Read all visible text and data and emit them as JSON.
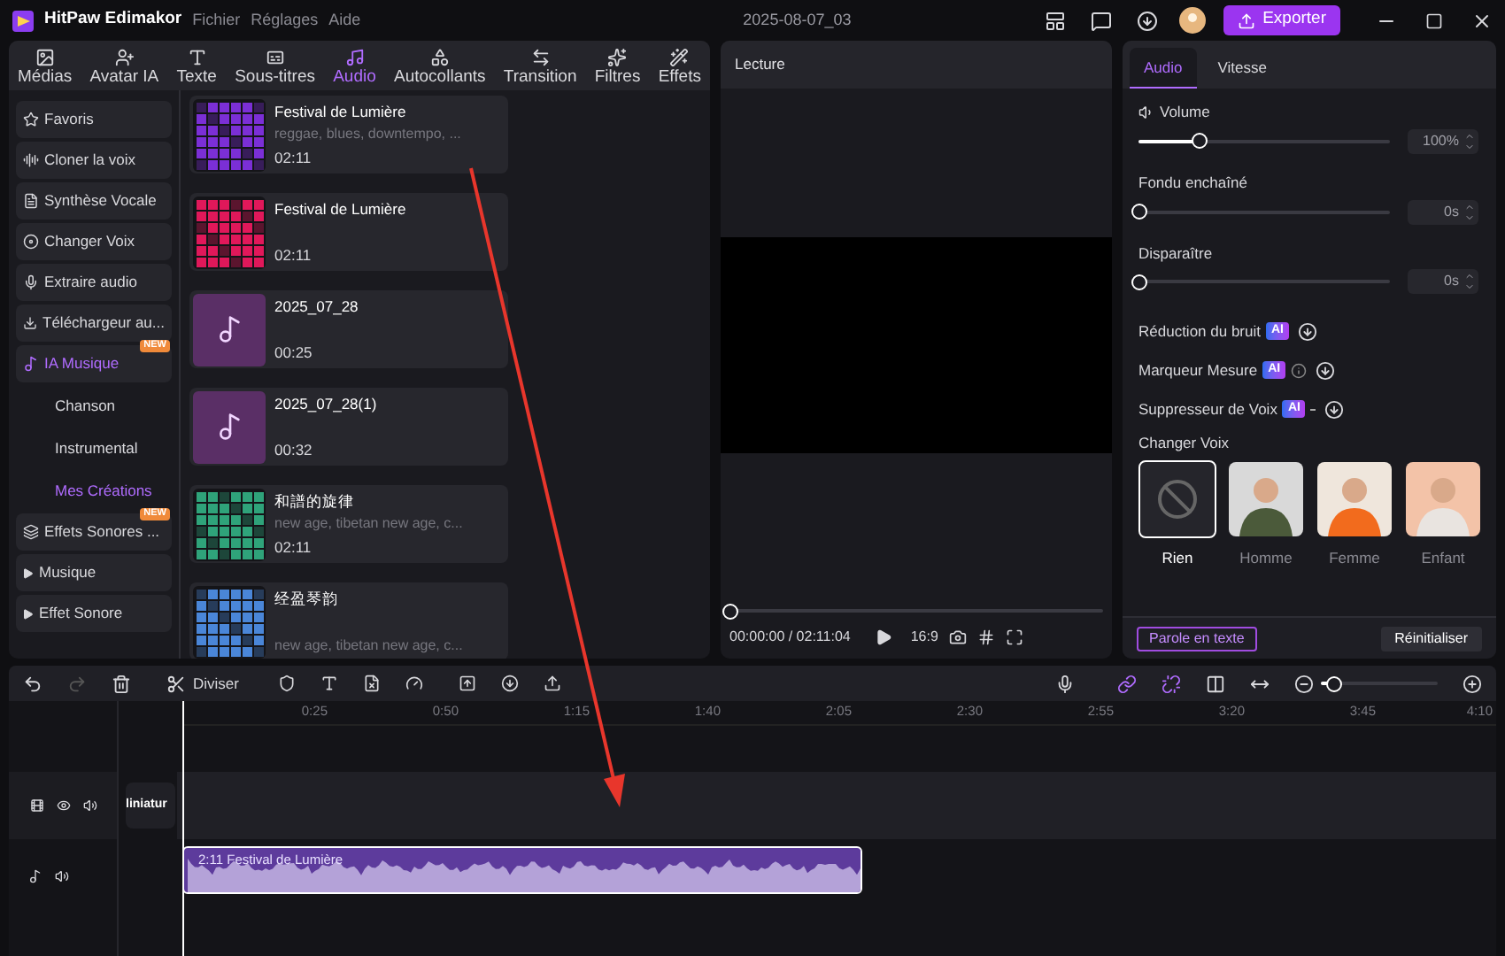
{
  "app": {
    "title": "HitPaw Edimakor",
    "menu": [
      "Fichier",
      "Réglages",
      "Aide"
    ],
    "project": "2025-08-07_03",
    "export": "Exporter"
  },
  "media_tabs": [
    {
      "label": "Médias",
      "selected": false
    },
    {
      "label": "Avatar IA",
      "selected": false
    },
    {
      "label": "Texte",
      "selected": false
    },
    {
      "label": "Sous-titres",
      "selected": false
    },
    {
      "label": "Audio",
      "selected": true
    },
    {
      "label": "Autocollants",
      "selected": false
    },
    {
      "label": "Transition",
      "selected": false
    },
    {
      "label": "Filtres",
      "selected": false
    },
    {
      "label": "Effets",
      "selected": false
    }
  ],
  "sidebar": [
    {
      "kind": "item",
      "label": "Favoris",
      "selected": false
    },
    {
      "kind": "item",
      "label": "Cloner la voix",
      "selected": false
    },
    {
      "kind": "item",
      "label": "Synthèse Vocale",
      "selected": false
    },
    {
      "kind": "item",
      "label": "Changer Voix",
      "selected": false
    },
    {
      "kind": "item",
      "label": "Extraire audio",
      "selected": false
    },
    {
      "kind": "item",
      "label": "Téléchargeur au...",
      "selected": false
    },
    {
      "kind": "item",
      "label": "IA Musique",
      "selected": true,
      "badge": "NEW"
    },
    {
      "kind": "sub",
      "label": "Chanson",
      "selected": false
    },
    {
      "kind": "sub",
      "label": "Instrumental",
      "selected": false
    },
    {
      "kind": "sub",
      "label": "Mes Créations",
      "selected": true
    },
    {
      "kind": "item",
      "label": "Effets Sonores ...",
      "selected": false,
      "badge": "NEW"
    },
    {
      "kind": "group",
      "label": "Musique",
      "selected": false
    },
    {
      "kind": "group",
      "label": "Effet Sonore",
      "selected": false
    }
  ],
  "tracks": [
    {
      "title": "Festival de Lumière",
      "tags": "reggae, blues, downtempo, ...",
      "duration": "02:11",
      "thumb": {
        "kind": "art",
        "color": "#7b2fd6"
      }
    },
    {
      "title": "Festival de Lumière",
      "duration": "02:11",
      "thumb": {
        "kind": "art",
        "color": "#e0185a"
      }
    },
    {
      "title": "2025_07_28",
      "duration": "00:25",
      "thumb": {
        "kind": "note"
      }
    },
    {
      "title": "2025_07_28(1)",
      "duration": "00:32",
      "thumb": {
        "kind": "note"
      }
    },
    {
      "title": "和譜的旋律",
      "tags": "new age, tibetan new age, c...",
      "duration": "02:11",
      "thumb": {
        "kind": "art",
        "color": "#2fa37a"
      }
    },
    {
      "title": "经盈琴韵",
      "tags": "new age, tibetan new age, c...",
      "thumb": {
        "kind": "art",
        "color": "#4a86d8"
      }
    }
  ],
  "preview": {
    "title": "Lecture",
    "level": 0,
    "time": "00:00:00 / 02:11:04",
    "ratio": "16:9"
  },
  "properties": {
    "tabs": [
      {
        "label": "Audio",
        "selected": true
      },
      {
        "label": "Vitesse",
        "selected": false
      }
    ],
    "sliders": [
      {
        "label": "Volume",
        "level": 0.24,
        "value": "100%"
      },
      {
        "label": "Fondu enchaîné",
        "level": 0,
        "value": "0s"
      },
      {
        "label": "Disparaître",
        "level": 0,
        "value": "0s"
      }
    ],
    "ai_tools": [
      {
        "label": "Réduction du bruit",
        "badge": "AI"
      },
      {
        "label": "Marqueur Mesure",
        "badge": "AI"
      },
      {
        "label": "Suppresseur de Voix",
        "badge": "AI"
      }
    ],
    "voice_heading": "Changer Voix",
    "voices": [
      {
        "label": "Rien",
        "kind": "none",
        "selected": true
      },
      {
        "label": "Homme",
        "kind": "picture",
        "selected": false,
        "color": "#d9d9d9"
      },
      {
        "label": "Femme",
        "kind": "picture",
        "selected": false,
        "color": "#efe6dc"
      },
      {
        "label": "Enfant",
        "kind": "picture",
        "selected": false,
        "color": "#f3c3a8"
      }
    ],
    "speech_button": "Parole en texte",
    "reset_button": "Réinitialiser"
  },
  "timeline": {
    "split": "Diviser",
    "zoom": {
      "level": 0.1
    },
    "ruler": [
      "0:25",
      "0:50",
      "1:15",
      "1:40",
      "2:05",
      "2:30",
      "2:55",
      "3:20",
      "3:45",
      "4:10"
    ],
    "video_clip": "liniatur",
    "audio_clip": "2:11 Festival de Lumière"
  }
}
